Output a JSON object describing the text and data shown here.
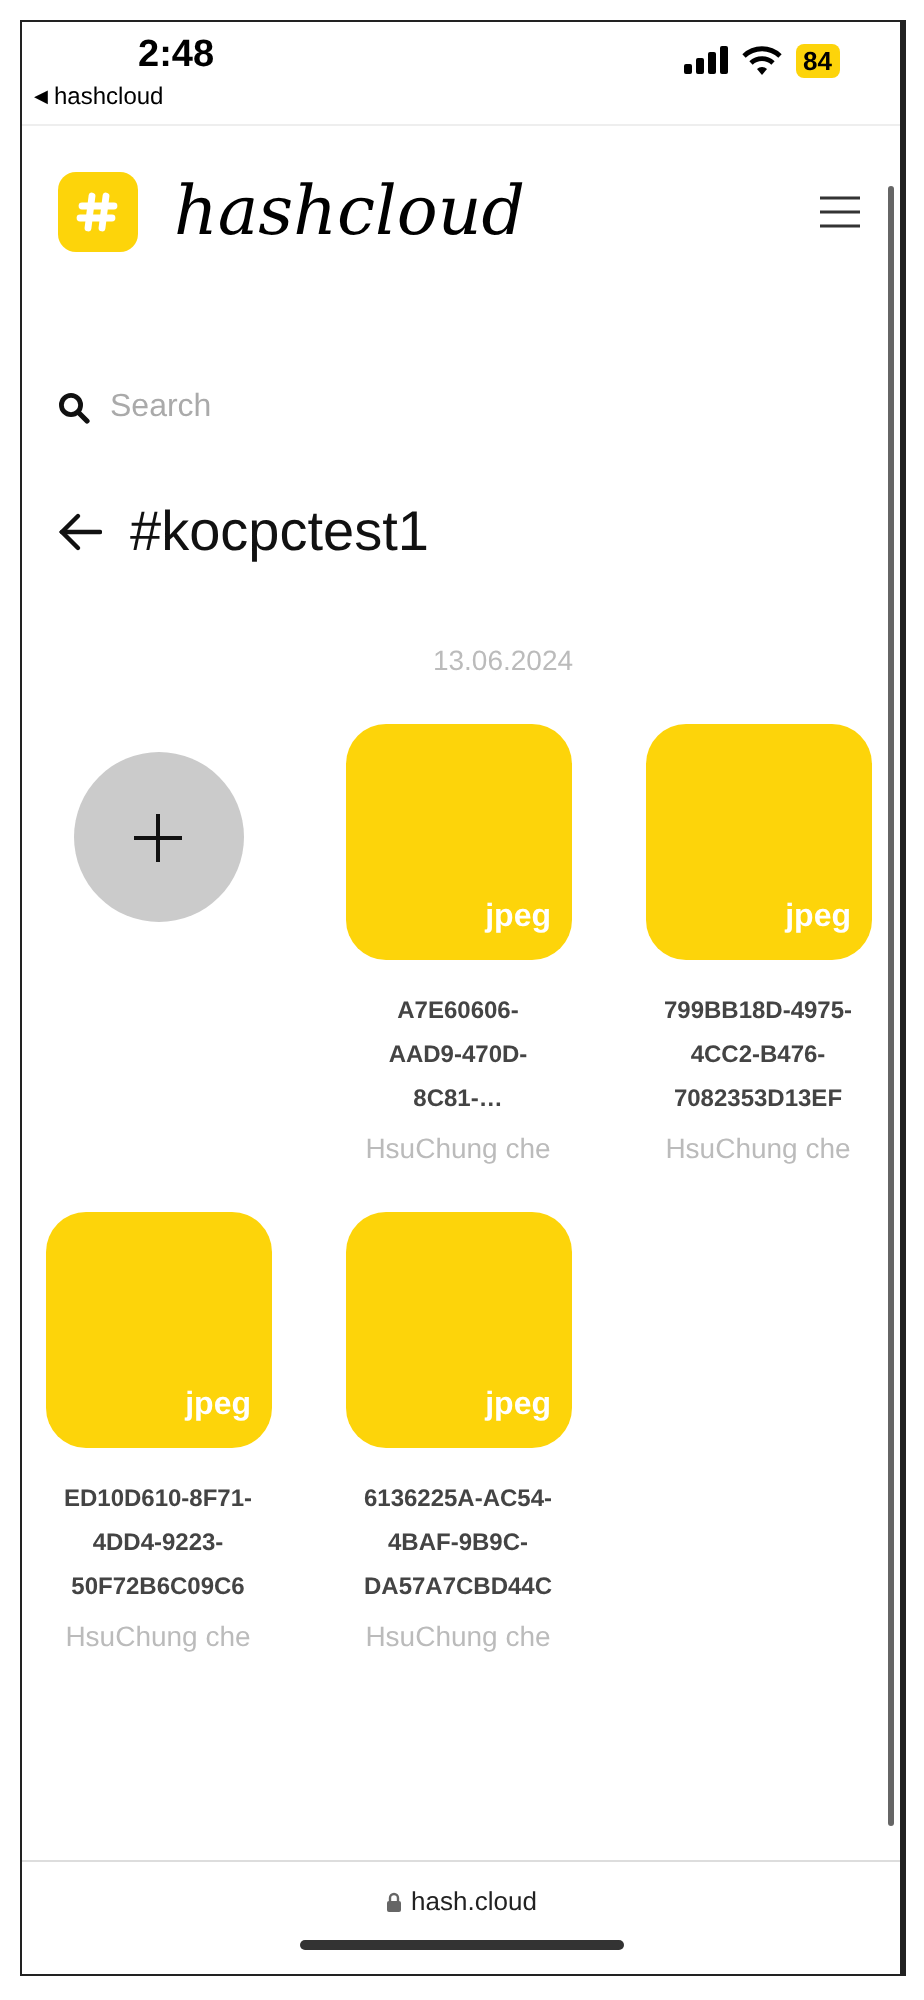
{
  "status_bar": {
    "time": "2:48",
    "back_arrow": "◀",
    "back_app": "hashcloud",
    "battery": "84"
  },
  "header": {
    "logo": "hashcloud"
  },
  "search": {
    "placeholder": "Search"
  },
  "title": "#kocpctest1",
  "date": "13.06.2024",
  "files": [
    {
      "kind": "add"
    },
    {
      "kind": "file",
      "type": "jpeg",
      "name_lines": [
        "A7E60606-",
        "AAD9-470D-",
        "8C81-…"
      ],
      "author": "HsuChung che"
    },
    {
      "kind": "file",
      "type": "jpeg",
      "name_lines": [
        "799BB18D-4975-",
        "4CC2-B476-",
        "7082353D13EF"
      ],
      "author": "HsuChung che"
    },
    {
      "kind": "file",
      "type": "jpeg",
      "name_lines": [
        "ED10D610-8F71-",
        "4DD4-9223-",
        "50F72B6C09C6"
      ],
      "author": "HsuChung che"
    },
    {
      "kind": "file",
      "type": "jpeg",
      "name_lines": [
        "6136225A-AC54-",
        "4BAF-9B9C-",
        "DA57A7CBD44C"
      ],
      "author": "HsuChung che"
    }
  ],
  "address_bar": {
    "url": "hash.cloud"
  }
}
